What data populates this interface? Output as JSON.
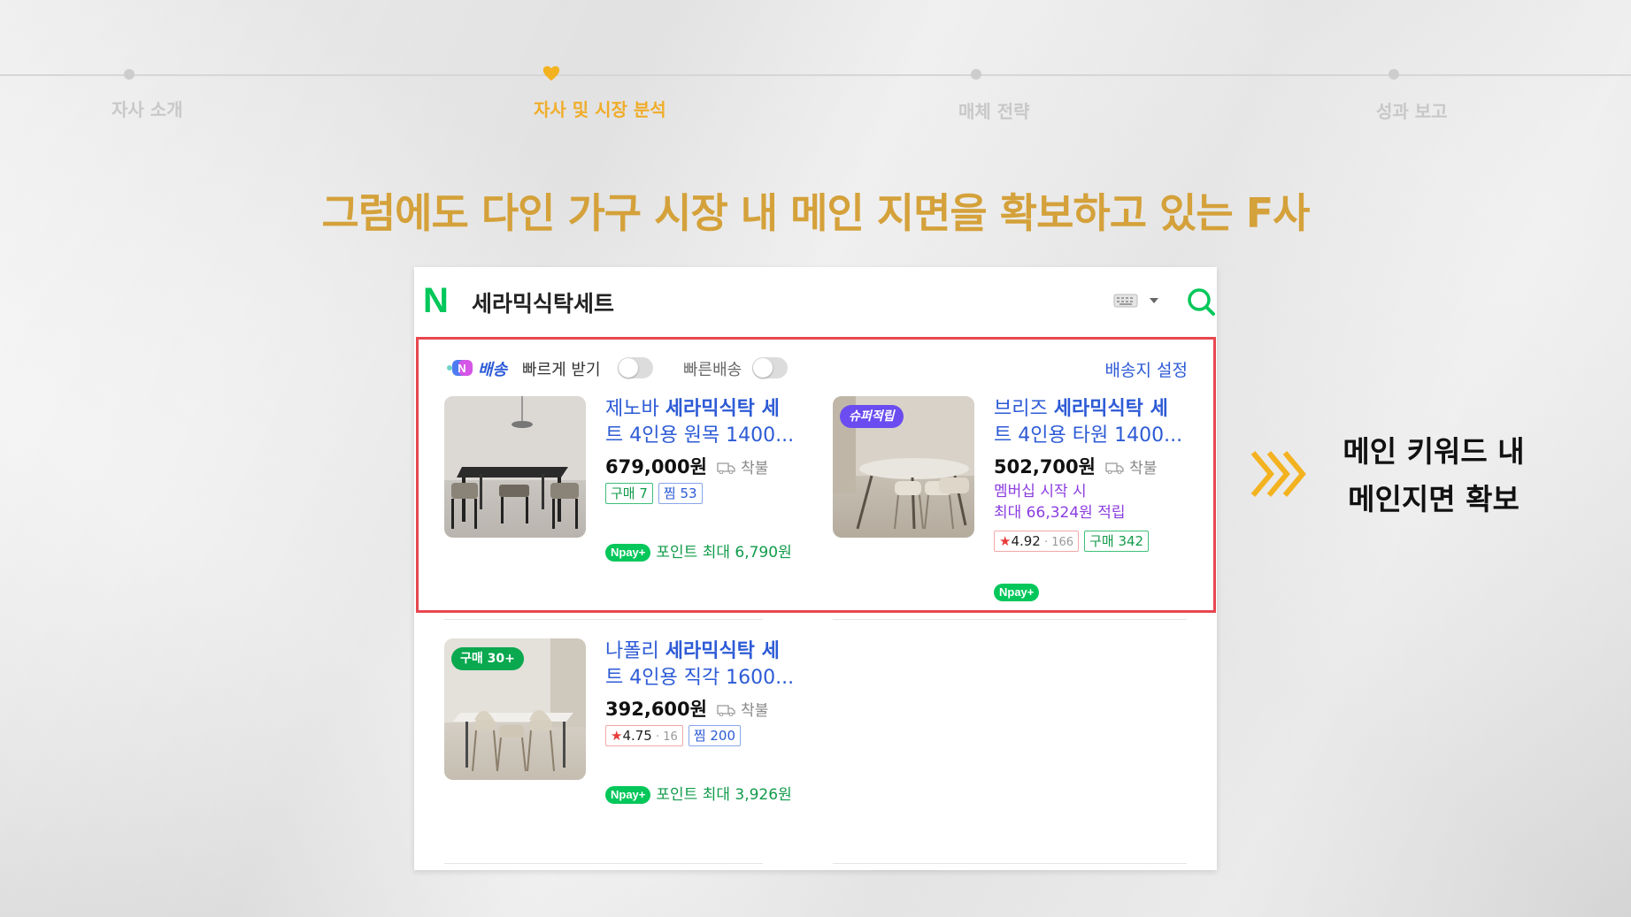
{
  "nav": {
    "steps": [
      {
        "label": "자사 소개",
        "active": false
      },
      {
        "label": "자사 및 시장 분석",
        "active": true
      },
      {
        "label": "매체 전략",
        "active": false
      },
      {
        "label": "성과 보고",
        "active": false
      }
    ],
    "accent_color": "#f0ad2b"
  },
  "headline": "그럼에도 다인 가구 시장 내 메인 지면을 확보하고 있는 F사",
  "search": {
    "logo": "N",
    "query": "세라믹식탁세트",
    "brand_color": "#03c75a"
  },
  "filters": {
    "badge": "배송",
    "fast_receive": "빠르게 받기",
    "fast_delivery": "빠른배송",
    "ship_setting": "배송지 설정"
  },
  "products": [
    {
      "brand": "제노바 ",
      "keyword": "세라믹식탁 세",
      "rest": "트 4인용 원목 1400...",
      "price": "679,000원",
      "shipping": "착불",
      "tag1": "구매 7",
      "tag2": "찜 53",
      "npay_label": "pay",
      "npay_text": "포인트 최대 6,790원"
    },
    {
      "badge": "슈퍼적립",
      "brand": "브리즈 ",
      "keyword": "세라믹식탁 세",
      "rest": "트 4인용 타원 1400...",
      "price": "502,700원",
      "shipping": "착불",
      "member_line1": "멤버십 시작 시",
      "member_line2": "최대 66,324원 적립",
      "rating": "4.92",
      "review_count": "166",
      "tag2": "구매 342",
      "npay_label": "pay"
    },
    {
      "badge": "구매 30+",
      "brand": "나폴리 ",
      "keyword": "세라믹식탁 세",
      "rest": "트 4인용 직각 1600...",
      "price": "392,600원",
      "shipping": "착불",
      "rating": "4.75",
      "review_count": "16",
      "tag2": "찜 200",
      "npay_label": "pay",
      "npay_text": "포인트 최대 3,926원"
    }
  ],
  "callout": {
    "line1": "메인 키워드 내",
    "line2": "메인지면 확보"
  },
  "highlight_color": "#e8474f"
}
